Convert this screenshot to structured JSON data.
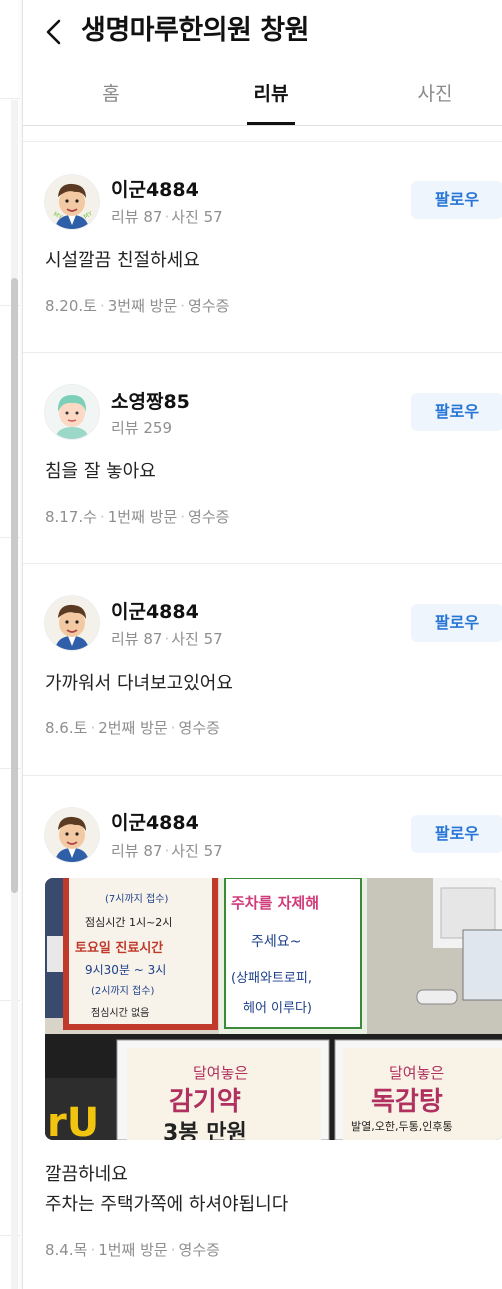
{
  "header": {
    "title": "생명마루한의원 창원"
  },
  "tabs": [
    {
      "label": "홈",
      "active": false
    },
    {
      "label": "리뷰",
      "active": true
    },
    {
      "label": "사진",
      "active": false
    }
  ],
  "reviews": [
    {
      "username": "이군4884",
      "reviews_label": "리뷰 87",
      "photos_label": "사진 57",
      "follow_label": "팔로우",
      "text": "시설깔끔 친절하세요",
      "date": "8.20.토",
      "visit": "3번째 방문",
      "receipt": "영수증",
      "avatar": "cartoon-man"
    },
    {
      "username": "소영짱85",
      "reviews_label": "리뷰 259",
      "follow_label": "팔로우",
      "text": "침을 잘 놓아요",
      "date": "8.17.수",
      "visit": "1번째 방문",
      "receipt": "영수증",
      "avatar": "mint-hair-person"
    },
    {
      "username": "이군4884",
      "reviews_label": "리뷰 87",
      "photos_label": "사진 57",
      "follow_label": "팔로우",
      "text": "가까워서 다녀보고있어요",
      "date": "8.6.토",
      "visit": "2번째 방문",
      "receipt": "영수증",
      "avatar": "cartoon-man"
    },
    {
      "username": "이군4884",
      "reviews_label": "리뷰 87",
      "photos_label": "사진 57",
      "follow_label": "팔로우",
      "text_line1": "깔끔하네요",
      "text_line2": "주차는 주택가쪽에 하셔야됩니다",
      "date": "8.4.목",
      "visit": "1번째 방문",
      "receipt": "영수증",
      "avatar": "cartoon-man",
      "photo": {
        "sign_hours_1": "(7시까지 접수)",
        "sign_lunch": "점심시간 1시~2시",
        "sign_saturday_title": "토요일 진료시간",
        "sign_saturday_hours": "9시30분 ~ 3시",
        "sign_saturday_note": "(2시까지 접수)",
        "sign_saturday_lunch": "점심시간 없음",
        "sign_parking_1": "주차를 자제해",
        "sign_parking_2": "주세요~",
        "sign_parking_3": "(상패와트로피,",
        "sign_parking_4": "헤어 이루다)",
        "box1_small": "달여놓은",
        "box1_big": "감기약",
        "box1_price": "3봉 만원",
        "box2_small": "달여놓은",
        "box2_big": "독감탕",
        "box2_sub": "발열,오한,두통,인후통"
      }
    }
  ],
  "colors": {
    "accent": "#2775d6",
    "follow_bg": "#eef5fd",
    "muted": "#8f8f8f"
  }
}
